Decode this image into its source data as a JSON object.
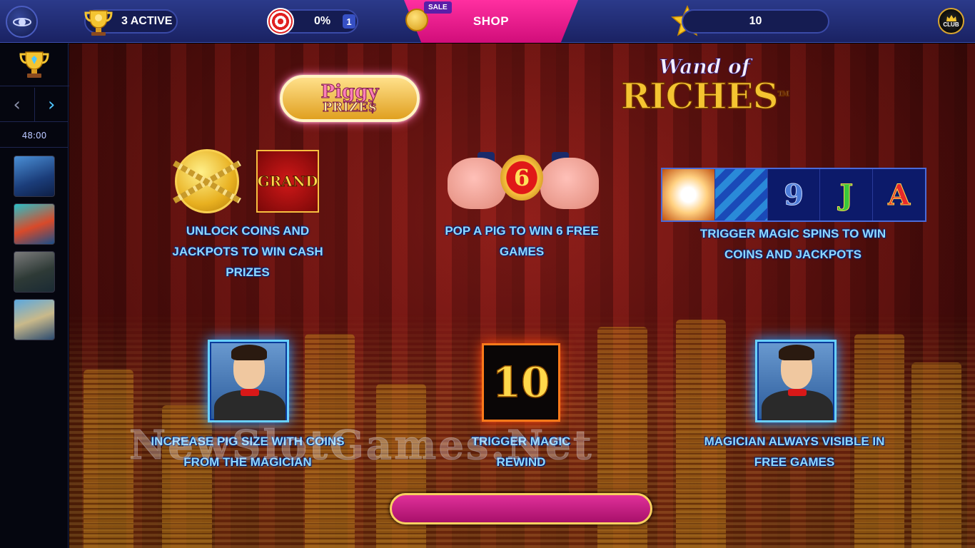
{
  "topbar": {
    "active_label": "3 ACTIVE",
    "progress_label": "0%",
    "progress_count": "1",
    "sale_label": "SALE",
    "shop_label": "SHOP",
    "stars_value": "10",
    "club_label": "CLUB"
  },
  "sidebar": {
    "timer": "48:00",
    "games": [
      "dolphin-game",
      "mermaid-game",
      "dark-warrior-game",
      "zeus-game"
    ]
  },
  "logos": {
    "piggy_line1": "Piggy",
    "piggy_line2": "PRIZE$",
    "wand_line1": "Wand of",
    "wand_line2": "RICHES",
    "trademark": "TM"
  },
  "features": {
    "grand_label": "GRAND",
    "coins_caption": "UNLOCK COINS AND JACKPOTS TO WIN CASH PRIZES",
    "free_games_number": "6",
    "pig_caption": "POP A PIG TO WIN 6 FREE GAMES",
    "reel_symbols": [
      "9",
      "J",
      "A"
    ],
    "magic_caption": "TRIGGER MAGIC SPINS TO WIN COINS AND JACKPOTS",
    "pig_size_caption": "INCREASE PIG SIZE WITH COINS FROM THE MAGICIAN",
    "rewind_number": "10",
    "rewind_caption": "TRIGGER MAGIC REWIND",
    "visible_caption": "MAGICIAN ALWAYS VISIBLE IN FREE GAMES"
  },
  "watermark": "NewSlotGames.Net",
  "colors": {
    "topbar": "#1a2263",
    "shop": "#e0208a",
    "caption": "#8fd8ff",
    "curtain": "#6a1310"
  }
}
